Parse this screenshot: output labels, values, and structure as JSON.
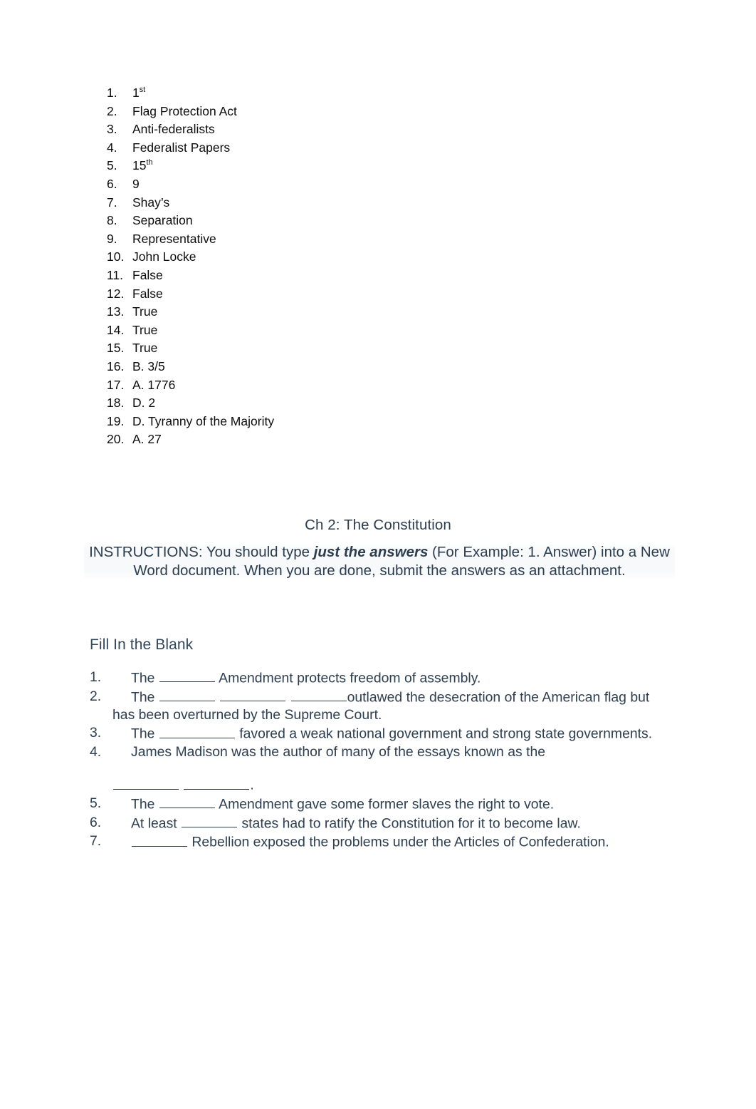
{
  "document": {
    "answers_list": [
      {
        "num": "1.",
        "text": "1",
        "sup": "st"
      },
      {
        "num": "2.",
        "text": " Flag Protection Act",
        "sup": ""
      },
      {
        "num": "3.",
        "text": "Anti-federalists",
        "sup": ""
      },
      {
        "num": "4.",
        "text": "Federalist Papers",
        "sup": ""
      },
      {
        "num": "5.",
        "text": "15",
        "sup": "th"
      },
      {
        "num": "6.",
        "text": "9",
        "sup": ""
      },
      {
        "num": "7.",
        "text": "Shay’s",
        "sup": ""
      },
      {
        "num": "8.",
        "text": "Separation",
        "sup": ""
      },
      {
        "num": "9.",
        "text": "Representative",
        "sup": ""
      },
      {
        "num": "10.",
        "text": "John Locke",
        "sup": ""
      },
      {
        "num": "11.",
        "text": "False",
        "sup": ""
      },
      {
        "num": "12.",
        "text": "False",
        "sup": ""
      },
      {
        "num": "13.",
        "text": "True",
        "sup": ""
      },
      {
        "num": "14.",
        "text": "True",
        "sup": ""
      },
      {
        "num": "15.",
        "text": "True",
        "sup": ""
      },
      {
        "num": "16.",
        "text": "B. 3/5",
        "sup": ""
      },
      {
        "num": "17.",
        "text": "A. 1776",
        "sup": ""
      },
      {
        "num": "18.",
        "text": "D. 2",
        "sup": ""
      },
      {
        "num": "19.",
        "text": "D. Tyranny of the Majority",
        "sup": ""
      },
      {
        "num": "20.",
        "text": "A. 27",
        "sup": ""
      }
    ],
    "chapter_title": "Ch 2: The Constitution",
    "instructions": {
      "part1": "INSTRUCTIONS:  You should type ",
      "emphasis": "just the answers",
      "part2": "  (For Example: 1. Answer) into a New Word document. When you are done, submit the answers as an attachment."
    },
    "section_heading": "Fill In the Blank",
    "fill_in_blank": [
      {
        "num": "1.",
        "seg1": "The ",
        "seg2": " Amendment protects freedom of assembly.",
        "seg3": "",
        "seg4": ""
      },
      {
        "num": "2.",
        "seg1": "The ",
        "seg2": " ",
        "seg3": " ",
        "seg4": "outlawed the desecration of the American flag but has been overturned by the Supreme Court."
      },
      {
        "num": "3.",
        "seg1": "The ",
        "seg2": " favored a weak national government and strong state governments.",
        "seg3": "",
        "seg4": ""
      },
      {
        "num": "4.",
        "seg1": "James Madison was the author of many of the essays known as the",
        "seg2": " ",
        "seg3": ".",
        "seg4": ""
      },
      {
        "num": "5.",
        "seg1": "The ",
        "seg2": " Amendment gave some former slaves the right to vote.",
        "seg3": "",
        "seg4": ""
      },
      {
        "num": "6.",
        "seg1": "At least ",
        "seg2": " states had to ratify the Constitution for it to become law.",
        "seg3": "",
        "seg4": ""
      },
      {
        "num": "7.",
        "seg1": " ",
        "seg2": " Rebellion exposed the problems under the Articles of Confederation.",
        "seg3": "",
        "seg4": ""
      }
    ]
  },
  "colors": {
    "answer_text": "#0d0d0d",
    "heading_text": "#2c3d4f",
    "body_text": "#2d3e50",
    "page_background": "#ffffff"
  }
}
